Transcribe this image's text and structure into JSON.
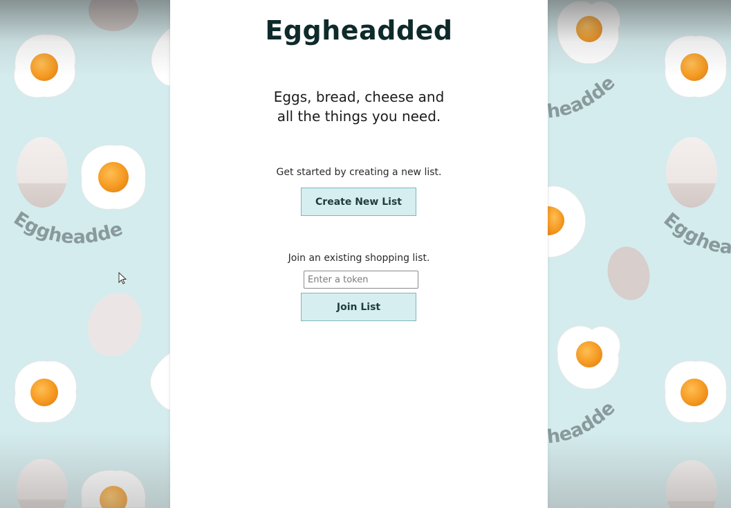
{
  "app": {
    "brand": "Eggheadded",
    "tagline_line1": "Eggs, bread, cheese and",
    "tagline_line2": "all the things you need."
  },
  "create": {
    "prompt": "Get started by creating a new list.",
    "button_label": "Create New List"
  },
  "join": {
    "prompt": "Join an existing shopping list.",
    "token_placeholder": "Enter a token",
    "token_value": "",
    "button_label": "Join List"
  },
  "background": {
    "wordmark": "Eggheadded",
    "wordmark_partial": "headded",
    "wordmark_partial_right": "Eggheac"
  },
  "colors": {
    "background": "#d4ecee",
    "button_fill": "#d6eef0",
    "button_border": "#7ab7bd",
    "yolk": "#f5a02a",
    "brand_text": "#0f2a2a"
  }
}
